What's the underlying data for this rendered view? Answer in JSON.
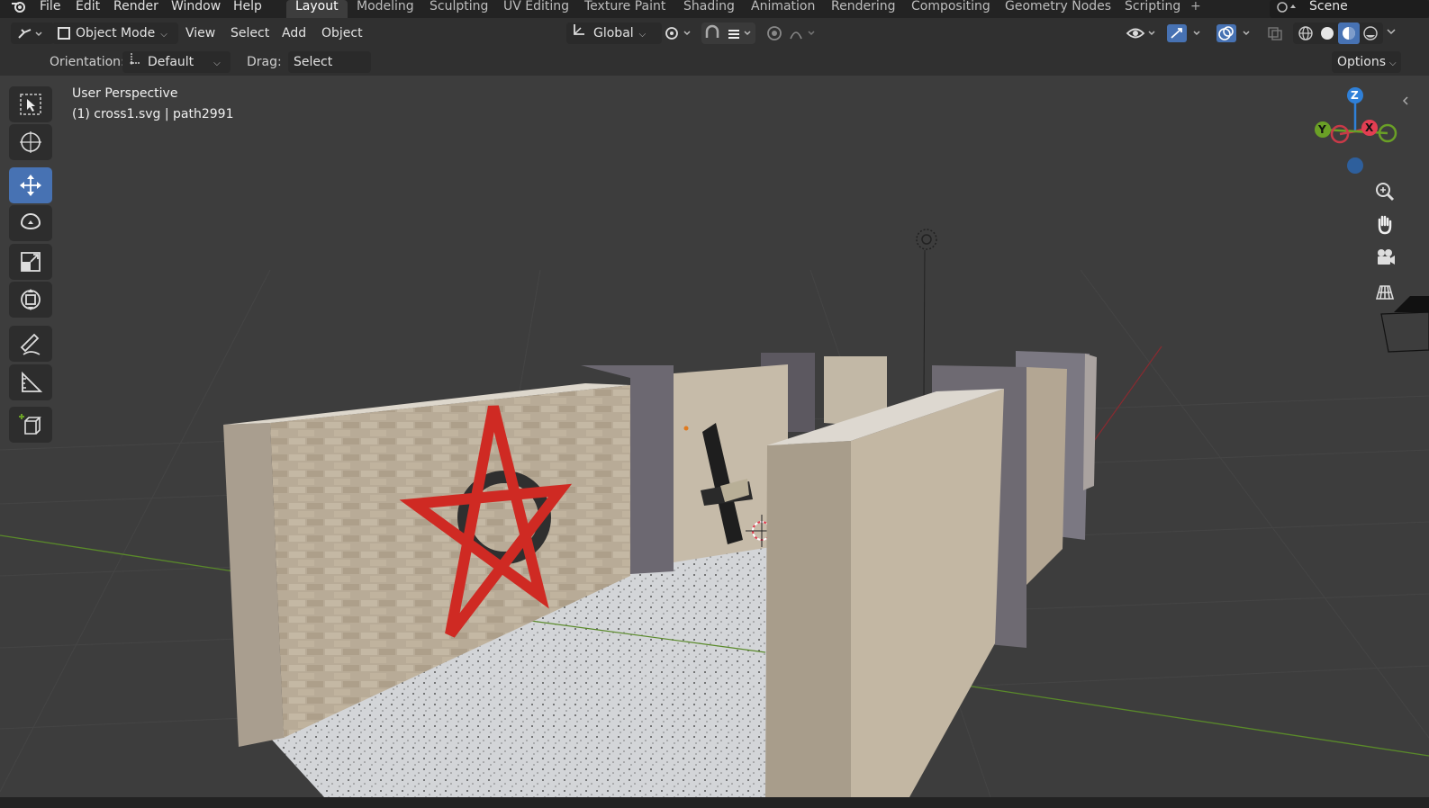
{
  "topbar": {
    "menus": [
      "File",
      "Edit",
      "Render",
      "Window",
      "Help"
    ],
    "workspaces": [
      "Layout",
      "Modeling",
      "Sculpting",
      "UV Editing",
      "Texture Paint",
      "Shading",
      "Animation",
      "Rendering",
      "Compositing",
      "Geometry Nodes",
      "Scripting"
    ],
    "add_tab": "+",
    "scene_label": "Scene"
  },
  "header": {
    "mode": "Object Mode",
    "view": "View",
    "select": "Select",
    "add": "Add",
    "object": "Object",
    "transform_orientation": "Global"
  },
  "tool_settings": {
    "orientation_label": "Orientation:",
    "orientation_value": "Default",
    "drag_label": "Drag:",
    "drag_value": "Select Box",
    "options": "Options"
  },
  "viewport": {
    "perspective": "User Perspective",
    "active_object": "(1) cross1.svg | path2991"
  },
  "gizmo": {
    "z_label": "Z",
    "y_label": "Y",
    "x_label": "X"
  },
  "colors": {
    "accent": "#4772b3",
    "axis_x": "#e23e52",
    "axis_y": "#6aa026",
    "axis_z": "#2f80d8"
  }
}
